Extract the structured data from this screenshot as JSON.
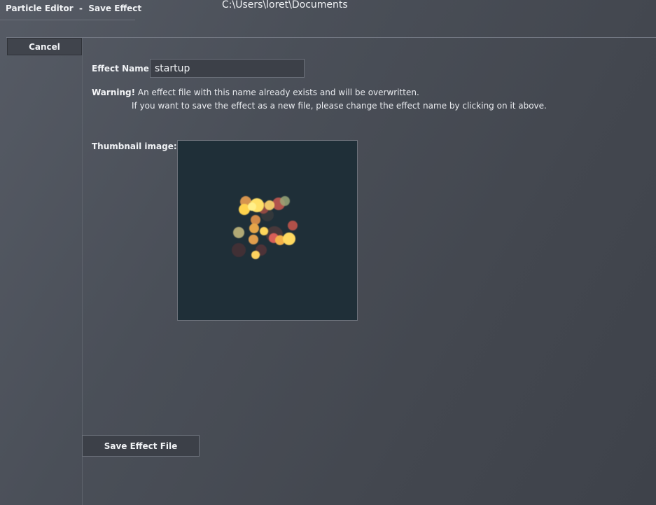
{
  "window": {
    "title": "Particle Editor  -  Save Effect",
    "path": "C:\\Users\\loret\\Documents"
  },
  "toolbar": {
    "cancel_label": "Cancel"
  },
  "form": {
    "effect_name_label": "Effect Name:",
    "effect_name_value": "startup",
    "warning_bold": "Warning!",
    "warning_line1": " An effect file with this name already exists and will be overwritten.",
    "warning_line2": "If you want to save the effect as a new file, please change the effect name by clicking on it above.",
    "thumbnail_label": "Thumbnail image:",
    "save_label": "Save Effect File"
  },
  "colors": {
    "thumbnail_background": "#1f2f38",
    "particle_yellow": "#ffe066",
    "particle_orange": "#e99a45",
    "particle_red": "#c0534a"
  }
}
